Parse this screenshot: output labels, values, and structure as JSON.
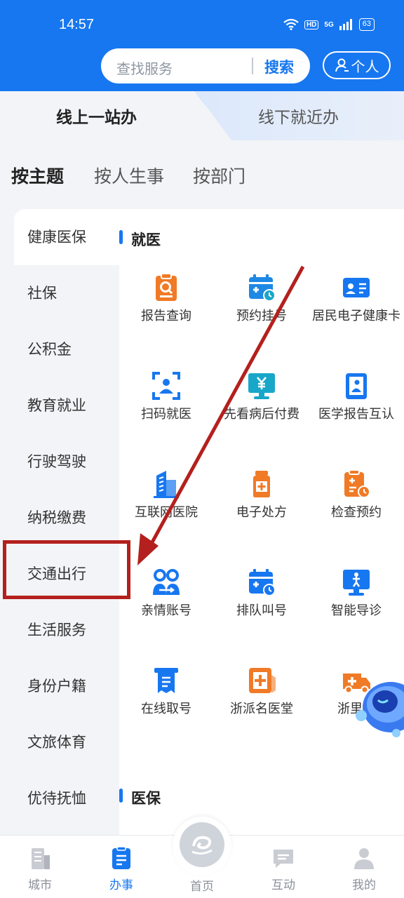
{
  "status_bar": {
    "time": "14:57",
    "network": "5G",
    "hd": "HD",
    "battery": "63"
  },
  "header": {
    "search_placeholder": "查找服务",
    "search_button": "搜索",
    "personal_button": "个人"
  },
  "top_tabs": [
    {
      "label": "线上一站办",
      "active": true
    },
    {
      "label": "线下就近办",
      "active": false
    }
  ],
  "category_tabs": [
    {
      "label": "按主题",
      "active": true
    },
    {
      "label": "按人生事",
      "active": false
    },
    {
      "label": "按部门",
      "active": false
    }
  ],
  "sidebar": {
    "items": [
      {
        "label": "健康医保",
        "active": true
      },
      {
        "label": "社保"
      },
      {
        "label": "公积金"
      },
      {
        "label": "教育就业"
      },
      {
        "label": "行驶驾驶"
      },
      {
        "label": "纳税缴费"
      },
      {
        "label": "交通出行",
        "highlighted": true
      },
      {
        "label": "生活服务"
      },
      {
        "label": "身份户籍"
      },
      {
        "label": "文旅体育"
      },
      {
        "label": "优待抚恤"
      }
    ]
  },
  "sections": [
    {
      "title": "就医",
      "items": [
        {
          "label": "报告查询",
          "icon": "report-search-icon",
          "color": "#f07a26"
        },
        {
          "label": "预约挂号",
          "icon": "calendar-appointment-icon",
          "color": "#1e88e5"
        },
        {
          "label": "居民电子健康卡",
          "icon": "health-card-icon",
          "color": "#1777f0"
        },
        {
          "label": "扫码就医",
          "icon": "scan-doctor-icon",
          "color": "#1777f0"
        },
        {
          "label": "先看病后付费",
          "icon": "monitor-yuan-icon",
          "color": "#19a7c9"
        },
        {
          "label": "医学报告互认",
          "icon": "medical-report-icon",
          "color": "#1777f0"
        },
        {
          "label": "互联网医院",
          "icon": "hospital-building-icon",
          "color": "#1777f0"
        },
        {
          "label": "电子处方",
          "icon": "medicine-bottle-icon",
          "color": "#f07a26"
        },
        {
          "label": "检查预约",
          "icon": "clipboard-clock-icon",
          "color": "#f07a26"
        },
        {
          "label": "亲情账号",
          "icon": "family-account-icon",
          "color": "#1777f0"
        },
        {
          "label": "排队叫号",
          "icon": "queue-calendar-icon",
          "color": "#1777f0"
        },
        {
          "label": "智能导诊",
          "icon": "smart-guide-icon",
          "color": "#1777f0"
        },
        {
          "label": "在线取号",
          "icon": "ticket-icon",
          "color": "#1777f0"
        },
        {
          "label": "浙派名医堂",
          "icon": "cross-box-icon",
          "color": "#f07a26"
        },
        {
          "label": "浙里急",
          "icon": "ambulance-icon",
          "color": "#f07a26"
        }
      ]
    },
    {
      "title": "医保",
      "items": []
    }
  ],
  "bottom_nav": [
    {
      "label": "城市",
      "icon": "city-icon",
      "active": false
    },
    {
      "label": "办事",
      "icon": "service-icon",
      "active": true
    },
    {
      "label": "首页",
      "icon": "home-logo-icon",
      "active": false
    },
    {
      "label": "互动",
      "icon": "chat-icon",
      "active": false
    },
    {
      "label": "我的",
      "icon": "user-icon",
      "active": false
    }
  ],
  "colors": {
    "brand": "#1777f0",
    "accent_orange": "#f07a26",
    "annotation_red": "#b3201d"
  }
}
